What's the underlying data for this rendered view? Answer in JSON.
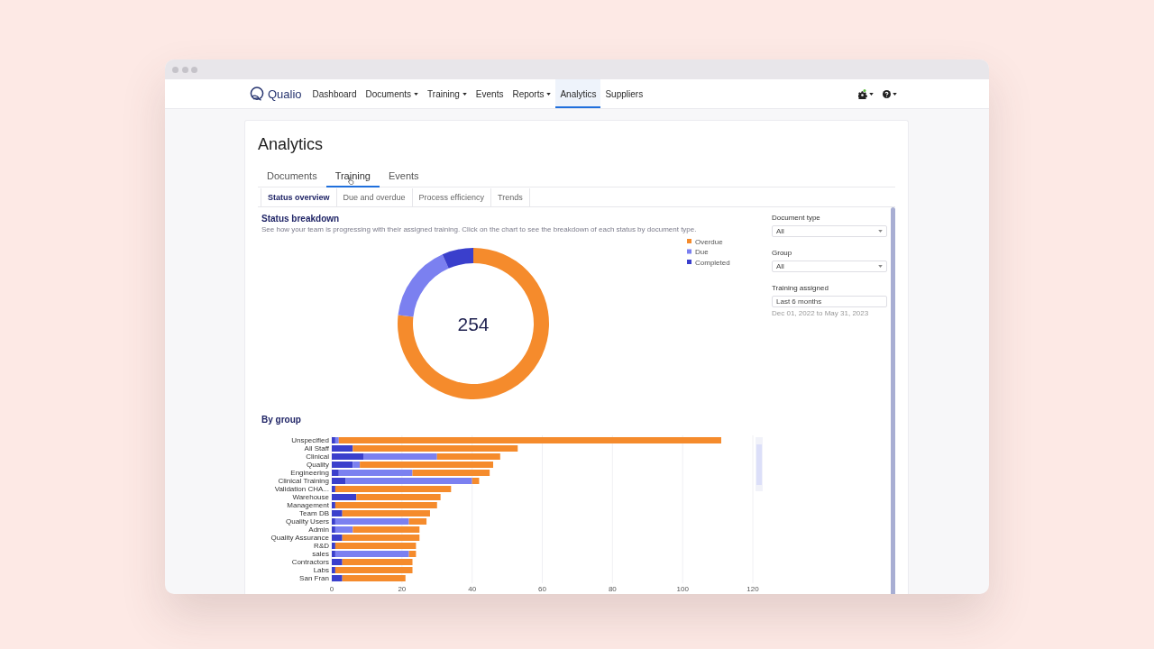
{
  "nav": {
    "logo": "Qualio",
    "items": [
      {
        "label": "Dashboard",
        "dropdown": false,
        "selected": false
      },
      {
        "label": "Documents",
        "dropdown": true,
        "selected": false
      },
      {
        "label": "Training",
        "dropdown": true,
        "selected": false
      },
      {
        "label": "Events",
        "dropdown": false,
        "selected": false
      },
      {
        "label": "Reports",
        "dropdown": true,
        "selected": false
      },
      {
        "label": "Analytics",
        "dropdown": false,
        "selected": true
      },
      {
        "label": "Suppliers",
        "dropdown": false,
        "selected": false
      }
    ]
  },
  "page": {
    "title": "Analytics"
  },
  "tabs": [
    {
      "label": "Documents",
      "selected": false,
      "hovered": false
    },
    {
      "label": "Training",
      "selected": true,
      "hovered": true
    },
    {
      "label": "Events",
      "selected": false,
      "hovered": false
    }
  ],
  "subtabs": [
    {
      "label": "Status overview",
      "selected": true
    },
    {
      "label": "Due and overdue",
      "selected": false
    },
    {
      "label": "Process efficiency",
      "selected": false
    },
    {
      "label": "Trends",
      "selected": false
    }
  ],
  "status_breakdown": {
    "title": "Status breakdown",
    "description": "See how your team is progressing with their assigned training. Click on the chart to see the breakdown of each status by document type.",
    "chart_data": {
      "type": "donut",
      "categories": [
        "Overdue",
        "Due",
        "Completed"
      ],
      "values": [
        76.8,
        16.5,
        6.7
      ],
      "colors": [
        "#f58b2c",
        "#7b80f0",
        "#3a3fcc"
      ],
      "legend": "top-right",
      "annotations": [
        "254"
      ]
    }
  },
  "filters": [
    {
      "kind": "select",
      "label": "Document type",
      "value": "All"
    },
    {
      "kind": "select",
      "label": "Group",
      "value": "All"
    },
    {
      "kind": "input",
      "label": "Training assigned",
      "value": "Last 6 months",
      "hint": "Dec 01, 2022 to May 31, 2023"
    }
  ],
  "by_group": {
    "title": "By group",
    "chart_data": {
      "type": "bar",
      "orientation": "horizontal",
      "stacked": true,
      "categories": [
        "Unspecified",
        "All Staff",
        "Clinical",
        "Quality",
        "Engineering",
        "Clinical Training",
        "Validation CHA...",
        "Warehouse",
        "Management",
        "Team DB",
        "Quality Users",
        "Admin",
        "Quality Assurance",
        "R&D",
        "sales",
        "Contractors",
        "Labs",
        "San Fran"
      ],
      "series": [
        {
          "color": "#3a3fcc",
          "values": [
            1,
            6,
            9,
            6,
            2,
            4,
            1,
            7,
            1,
            3,
            1,
            1,
            3,
            1,
            1,
            3,
            1,
            3
          ]
        },
        {
          "color": "#7b80f0",
          "values": [
            1,
            0,
            21,
            2,
            21,
            36,
            0,
            0,
            0,
            0,
            21,
            5,
            0,
            0,
            21,
            0,
            0,
            0
          ]
        },
        {
          "color": "#f58b2c",
          "values": [
            109,
            47,
            18,
            38,
            22,
            2,
            33,
            24,
            29,
            25,
            5,
            19,
            22,
            23,
            2,
            20,
            22,
            18
          ]
        }
      ],
      "xlim": [
        0,
        120
      ],
      "xticks": [
        0,
        20,
        40,
        60,
        80,
        100,
        120
      ],
      "grid": true
    }
  }
}
